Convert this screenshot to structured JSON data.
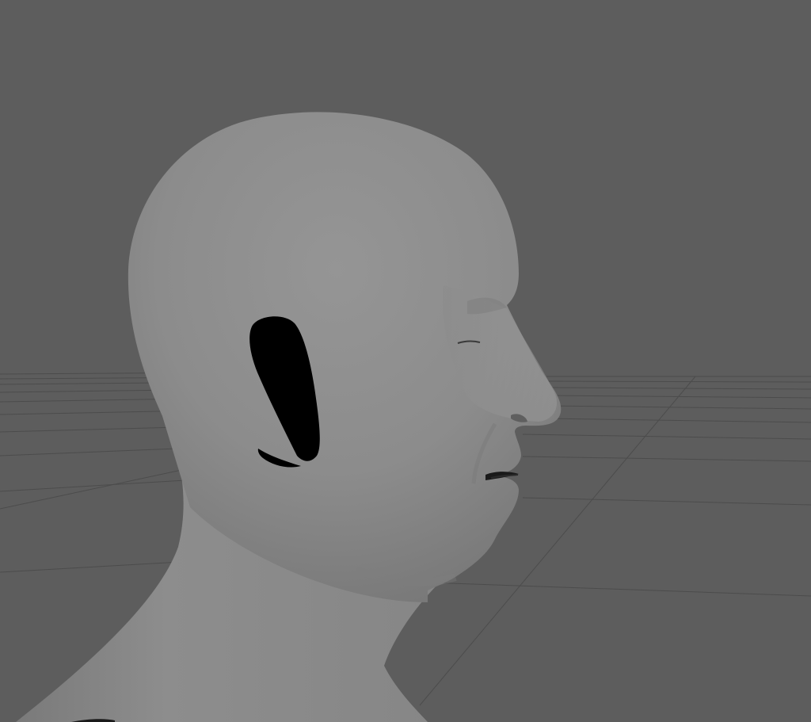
{
  "viewport": {
    "view": "perspective",
    "background_color": "#5d5d5d",
    "grid_visible": true,
    "grid_color": "#4c4c4c",
    "model": {
      "type": "head-and-neck-sculpt",
      "orientation": "right-profile",
      "shading": "smooth-gray",
      "base_color": "#8c8c8c",
      "artifact": "ear-hole-black"
    }
  }
}
